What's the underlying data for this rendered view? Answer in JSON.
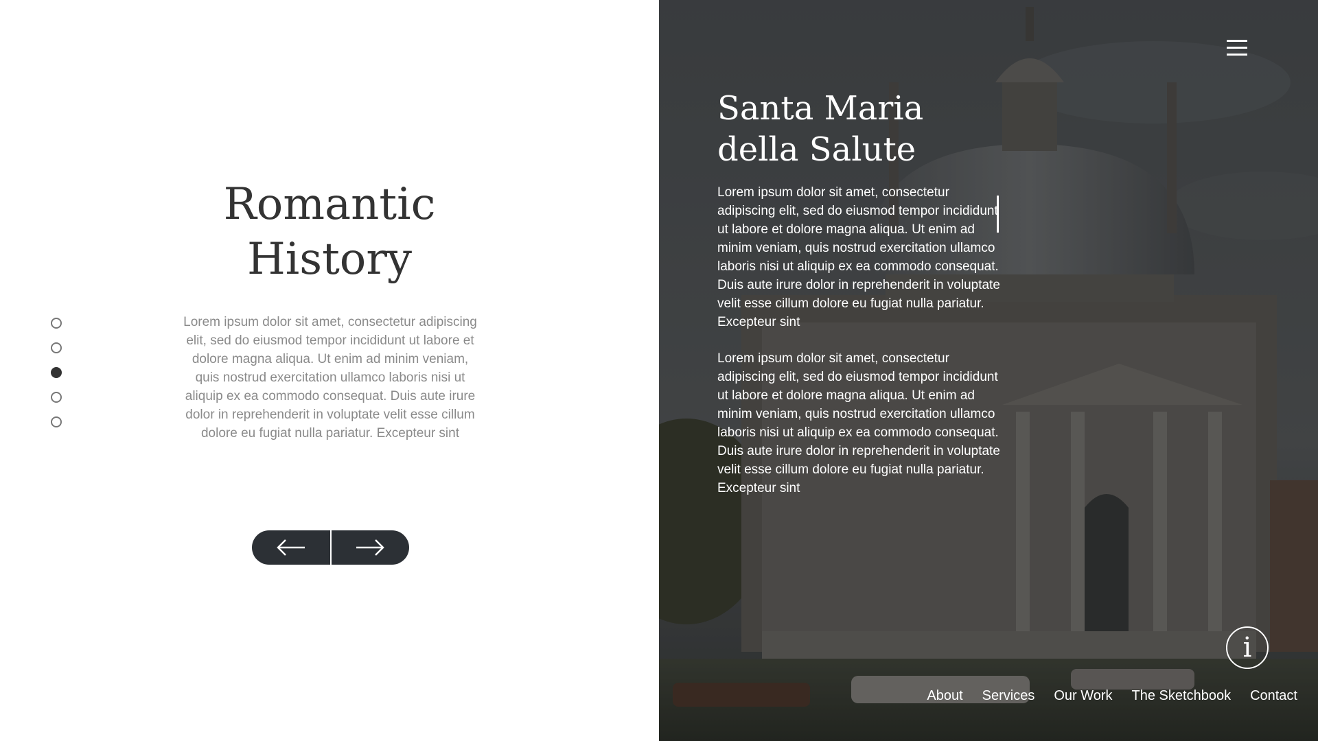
{
  "left": {
    "title_line1": "Romantic",
    "title_line2": "History",
    "body": "Lorem ipsum dolor sit amet, consectetur adipiscing elit, sed do eiusmod tempor incididunt ut labore et dolore magna aliqua. Ut enim ad minim veniam, quis nostrud exercitation ullamco laboris nisi ut aliquip ex ea commodo consequat. Duis aute irure dolor in reprehenderit in voluptate velit esse cillum dolore eu fugiat nulla pariatur. Excepteur sint",
    "pagination": {
      "total": 5,
      "active_index": 3
    },
    "prev_icon": "arrow-left-icon",
    "next_icon": "arrow-right-icon"
  },
  "right": {
    "title_line1": "Santa Maria",
    "title_line2": "della Salute",
    "paragraphs": [
      "Lorem ipsum dolor sit amet, consectetur adipiscing elit, sed do eiusmod tempor incididunt ut labore et dolore magna aliqua. Ut enim ad minim veniam, quis nostrud exercitation ullamco laboris nisi ut aliquip ex ea commodo consequat. Duis aute irure dolor in reprehenderit in voluptate velit esse cillum dolore eu fugiat nulla pariatur. Excepteur sint",
      "Lorem ipsum dolor sit amet, consectetur adipiscing elit, sed do eiusmod tempor incididunt ut labore et dolore magna aliqua. Ut enim ad minim veniam, quis nostrud exercitation ullamco laboris nisi ut aliquip ex ea commodo consequat. Duis aute irure dolor in reprehenderit in voluptate velit esse cillum dolore eu fugiat nulla pariatur. Excepteur sint"
    ],
    "menu_icon": "hamburger-menu-icon",
    "info_icon_glyph": "i",
    "footer_nav": [
      "About",
      "Services",
      "Our Work",
      "The Sketchbook",
      "Contact"
    ]
  },
  "colors": {
    "dark": "#2c3035",
    "heading": "#333333",
    "muted_text": "#8a8a8a",
    "overlay_text": "#ffffff"
  }
}
